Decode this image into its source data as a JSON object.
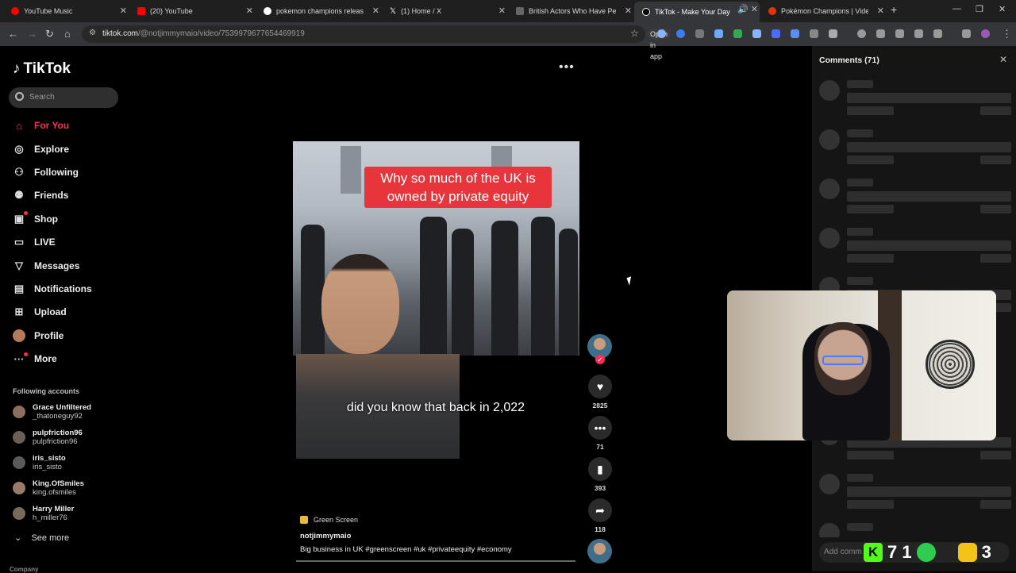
{
  "browser": {
    "tabs": [
      {
        "title": "YouTube Music",
        "color": "#ff0000"
      },
      {
        "title": "(20) YouTube",
        "color": "#ff0000"
      },
      {
        "title": "pokemon champions release da",
        "color": "#4285f4"
      },
      {
        "title": "(1) Home / X",
        "color": "#ffffff"
      },
      {
        "title": "British Actors Who Have Perfec",
        "color": "#888888"
      },
      {
        "title": "TikTok - Make Your Day",
        "color": "#ffffff"
      },
      {
        "title": "Pokémon Champions | Video G",
        "color": "#e3350d"
      }
    ],
    "url_host": "tiktok.com",
    "url_path": "/@notjimmymaio/video/7539979677654469919",
    "open_in_app": "Open in app"
  },
  "tiktok": {
    "logo": "TikTok",
    "search_placeholder": "Search",
    "nav": [
      {
        "label": "For You",
        "icon": "home-icon"
      },
      {
        "label": "Explore",
        "icon": "compass-icon"
      },
      {
        "label": "Following",
        "icon": "following-icon"
      },
      {
        "label": "Friends",
        "icon": "friends-icon"
      },
      {
        "label": "Shop",
        "icon": "shop-icon"
      },
      {
        "label": "LIVE",
        "icon": "live-icon"
      },
      {
        "label": "Messages",
        "icon": "messages-icon"
      },
      {
        "label": "Notifications",
        "icon": "notifications-icon"
      },
      {
        "label": "Upload",
        "icon": "upload-icon"
      },
      {
        "label": "Profile",
        "icon": "profile-icon"
      },
      {
        "label": "More",
        "icon": "more-icon"
      }
    ],
    "following_title": "Following accounts",
    "accounts": [
      {
        "name": "Grace Unfiltered",
        "handle": "_thatoneguy92"
      },
      {
        "name": "pulpfriction96",
        "handle": "pulpfriction96"
      },
      {
        "name": "iris_sisto",
        "handle": "iris_sisto"
      },
      {
        "name": "King.OfSmiles",
        "handle": "king.ofsmiles"
      },
      {
        "name": "Harry Miller",
        "handle": "h_miller76"
      }
    ],
    "see_more": "See more",
    "company": "Company"
  },
  "video": {
    "headline": "Why so much of the UK is owned by private equity",
    "caption": "did you know that back in 2,022",
    "effect": "Green Screen",
    "author": "notjimmymaio",
    "description": "Big business in UK #greenscreen  #uk  #privateequity  #economy",
    "likes": "2825",
    "comments": "71",
    "saves": "393",
    "shares": "118"
  },
  "comments_panel": {
    "title": "Comments (71)",
    "add_placeholder": "Add comm"
  },
  "overlay": {
    "k_label": "K",
    "left_number": "7 1",
    "right_number": "3"
  }
}
